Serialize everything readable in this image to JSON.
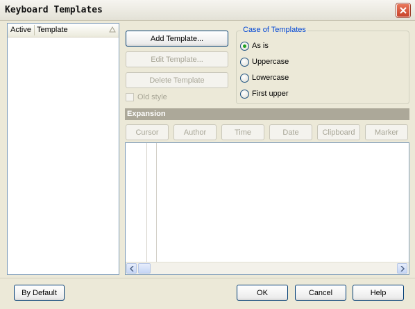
{
  "window": {
    "title": "Keyboard Templates"
  },
  "list": {
    "col_active": "Active",
    "col_template": "Template"
  },
  "buttons": {
    "add_template": "Add Template...",
    "edit_template": "Edit Template...",
    "delete_template": "Delete Template",
    "by_default": "By Default",
    "ok": "OK",
    "cancel": "Cancel",
    "help": "Help"
  },
  "old_style": {
    "label": "Old style",
    "checked": false,
    "enabled": false
  },
  "case_group": {
    "title": "Case of Templates",
    "options": [
      "As is",
      "Uppercase",
      "Lowercase",
      "First upper"
    ],
    "selected": "As is"
  },
  "expansion": {
    "title": "Expansion",
    "buttons": [
      "Cursor",
      "Author",
      "Time",
      "Date",
      "Clipboard",
      "Marker"
    ]
  },
  "colors": {
    "accent_title": "#0046d5",
    "radio_dot": "#21a121",
    "close": "#c8412a"
  }
}
